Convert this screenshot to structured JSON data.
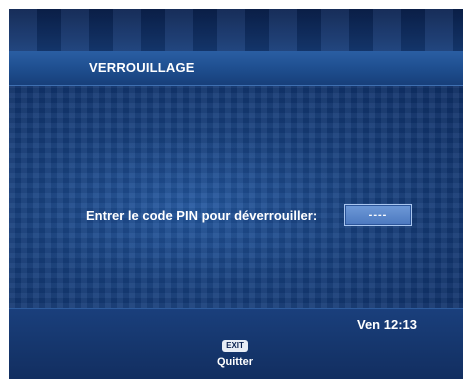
{
  "header": {
    "title": "VERROUILLAGE"
  },
  "main": {
    "pin_prompt": "Entrer le code PIN pour déverrouiller:",
    "pin_value": "----"
  },
  "footer": {
    "clock": "Ven 12:13",
    "exit_key": "EXIT",
    "exit_label": "Quitter"
  },
  "colors": {
    "background": "#0e2a5a",
    "title_bar": "#1f4f90",
    "pin_field": "#5a86cb",
    "text": "#ffffff"
  }
}
